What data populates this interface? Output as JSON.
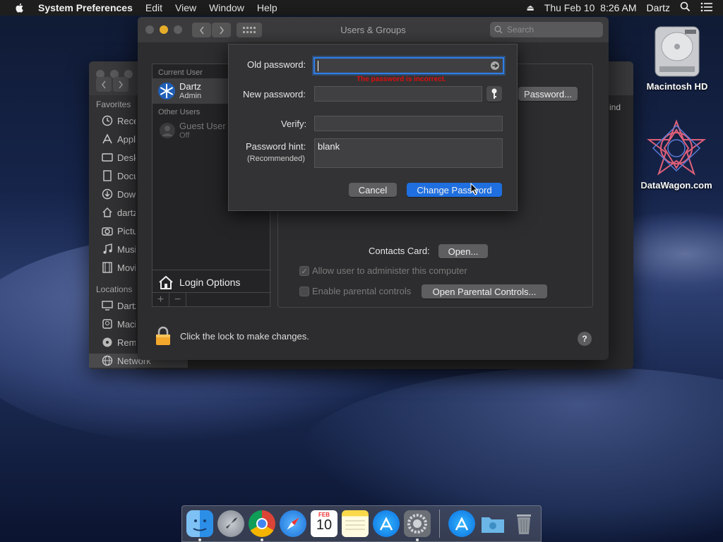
{
  "menubar": {
    "app_name": "System Preferences",
    "items": [
      "Edit",
      "View",
      "Window",
      "Help"
    ],
    "datetime": "Thu Feb 10  8:26 AM",
    "user": "Dartz"
  },
  "desktop": {
    "icons": [
      {
        "label": "Macintosh HD",
        "icon": "hard-drive-icon"
      },
      {
        "label": "DataWagon.com",
        "icon": "datawagon-logo-icon"
      }
    ]
  },
  "finder": {
    "sidebar_sections": [
      "Favorites",
      "Locations"
    ],
    "favorites": [
      {
        "label": "Recents",
        "icon": "clock-icon"
      },
      {
        "label": "Applications",
        "icon": "applications-icon"
      },
      {
        "label": "Desktop",
        "icon": "desktop-icon"
      },
      {
        "label": "Documents",
        "icon": "documents-icon"
      },
      {
        "label": "Downloads",
        "icon": "downloads-icon"
      },
      {
        "label": "dartz",
        "icon": "home-icon"
      },
      {
        "label": "Pictures",
        "icon": "camera-icon"
      },
      {
        "label": "Music",
        "icon": "music-icon"
      },
      {
        "label": "Movies",
        "icon": "movies-icon"
      }
    ],
    "locations": [
      {
        "label": "Dartz",
        "icon": "computer-icon"
      },
      {
        "label": "Macintosh HD",
        "icon": "disk-icon"
      },
      {
        "label": "Remote Disc",
        "icon": "disc-icon"
      },
      {
        "label": "Network",
        "icon": "network-icon"
      }
    ],
    "column_header": "ind"
  },
  "prefs": {
    "title": "Users & Groups",
    "search_placeholder": "Search",
    "current_user_header": "Current User",
    "current_user_name": "Dartz",
    "current_user_role": "Admin",
    "other_users_header": "Other Users",
    "guest_name": "Guest User",
    "guest_status": "Off",
    "login_options": "Login Options",
    "change_password_button": "Password...",
    "contacts_card_label": "Contacts Card:",
    "open_button": "Open...",
    "allow_admin_label": "Allow user to administer this computer",
    "allow_admin_checked": true,
    "parental_label": "Enable parental controls",
    "parental_checked": false,
    "open_parental_button": "Open Parental Controls...",
    "lock_text": "Click the lock to make changes.",
    "help_label": "?"
  },
  "sheet": {
    "old_password_label": "Old password:",
    "old_password_value": "",
    "error_text": "The password is incorrect.",
    "new_password_label": "New password:",
    "new_password_value": "",
    "verify_label": "Verify:",
    "verify_value": "",
    "hint_label": "Password hint:",
    "hint_sublabel": "(Recommended)",
    "hint_value": "blank",
    "cancel_button": "Cancel",
    "change_button": "Change Password"
  },
  "dock": {
    "apps": [
      "Finder",
      "Launchpad",
      "Google Chrome",
      "Safari",
      "Calendar",
      "Notes",
      "App Store",
      "System Preferences",
      "App Store Downloads",
      "Downloads",
      "Trash"
    ],
    "calendar_month": "FEB",
    "calendar_day": "10"
  },
  "colors": {
    "accent": "#1f6fe0",
    "error": "#e10d0d"
  }
}
